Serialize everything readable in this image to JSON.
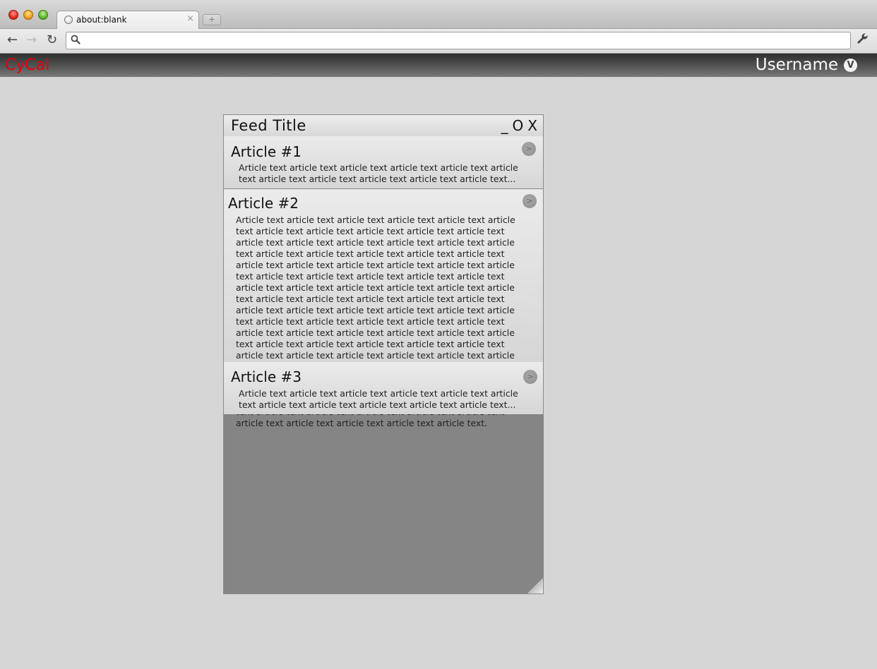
{
  "browser": {
    "tab_title": "about:blank",
    "tab_close": "×",
    "new_tab": "+",
    "address_value": "",
    "address_placeholder": "",
    "back": "←",
    "forward": "→",
    "reload": "↻",
    "wrench": "🔧",
    "search_glyph": "🔍"
  },
  "app": {
    "brand": "CyCal",
    "brand_color": "#e8000a",
    "username": "Username",
    "user_menu_glyph": "V"
  },
  "feed": {
    "title": "Feed Title",
    "controls": {
      "minimize": "_",
      "maximize": "O",
      "close": "X"
    },
    "articles": [
      {
        "title": "Article #1",
        "button": ">",
        "text": "Article text article text article text article text article text article text article text article text article text article text article text..."
      },
      {
        "title": "Article #2",
        "button": ">",
        "text": "Article text article text article text article text article text article text article text article text article text article text article text article text article text article text article text article text article text article text article text article text article text article text article text article text article text article text article text article text article text article text article text article text article text article text article text article text article text article text article text article text article text article text article text article text article text article text article text article text article text article text article text article text article text article text article text article text article text article text article text article text article text article text article text article text article text article text article text article text article text article text article text article text article text article text article text article text article text article text article text article text article text article text article text article text article text article text article text article text article text article text article text article text article text article text article text article text article text article text article text article text article text article text article text article text."
      },
      {
        "title": "Article #3",
        "button": ">",
        "text": "Article text article text article text article text article text article text article text article text article text article text article text..."
      }
    ]
  }
}
